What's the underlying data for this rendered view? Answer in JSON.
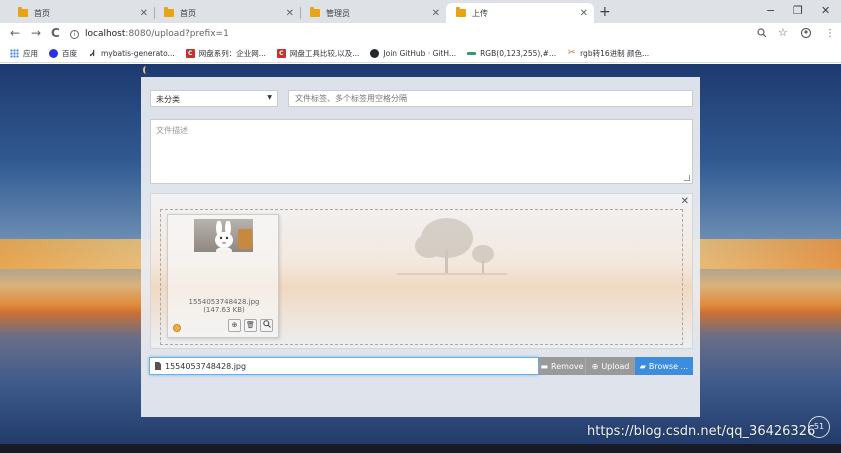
{
  "browser": {
    "tabs": [
      {
        "title": "首页",
        "active": false
      },
      {
        "title": "首页",
        "active": false
      },
      {
        "title": "管理员",
        "active": false
      },
      {
        "title": "上传",
        "active": true
      }
    ],
    "new_tab": "+",
    "window": {
      "minimize": "−",
      "restore": "❐",
      "close": "✕"
    },
    "nav": {
      "back": "←",
      "forward": "→",
      "reload": "C"
    },
    "url": {
      "host": "localhost",
      "rest": ":8080/upload?prefix=1"
    },
    "bookmarks": [
      {
        "label": "应用",
        "icon": "apps-icon",
        "color": "#4285f4"
      },
      {
        "label": "百度",
        "icon": "baidu-icon",
        "color": "#2932e1"
      },
      {
        "label": "mybatis-generato...",
        "icon": "mybatis-icon",
        "color": "#333333"
      },
      {
        "label": "网盘系列：企业网...",
        "icon": "csdn-icon",
        "color": "#c9302c"
      },
      {
        "label": "网盘工具比较,以及...",
        "icon": "csdn-icon",
        "color": "#c9302c"
      },
      {
        "label": "Join GitHub · GitH...",
        "icon": "github-icon",
        "color": "#24292e"
      },
      {
        "label": "RGB(0,123,255),#...",
        "icon": "rgb-icon",
        "color": "#2f9e6e"
      },
      {
        "label": "rgb转16进制 颜色...",
        "icon": "tools-icon",
        "color": "#d2691e"
      }
    ]
  },
  "form": {
    "category": "未分类",
    "tags_placeholder": "文件标签、多个标签用空格分隔",
    "description_placeholder": "文件描述"
  },
  "upload": {
    "file": {
      "caption_line1": "1554053748428.jpg",
      "caption_line2": "(147.63 KB)",
      "status": "pending"
    },
    "caption_value": "1554053748428.jpg",
    "buttons": {
      "remove": "Remove",
      "upload": "Upload",
      "browse": "Browse ..."
    }
  },
  "watermark": "https://blog.csdn.net/qq_36426326",
  "corner_badge": "51",
  "colors": {
    "browse": "#3c8dde",
    "remove": "#9a9a9a",
    "focus": "#66afe9"
  }
}
